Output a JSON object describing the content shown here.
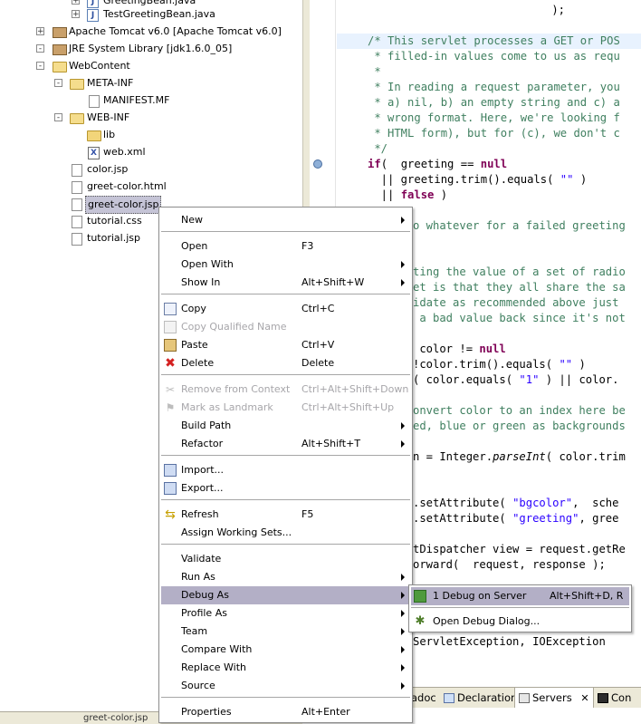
{
  "tree": {
    "items": [
      {
        "label": "GreetingBean.java",
        "icon": "java-file-icon"
      },
      {
        "label": "TestGreetingBean.java",
        "icon": "java-file-icon"
      },
      {
        "label": "Apache Tomcat v6.0 [Apache Tomcat v6.0]",
        "icon": "library-jar-icon"
      },
      {
        "label": "JRE System Library [jdk1.6.0_05]",
        "icon": "library-jar-icon"
      },
      {
        "label": "WebContent",
        "icon": "folder-open-icon"
      },
      {
        "label": "META-INF",
        "icon": "folder-open-icon"
      },
      {
        "label": "MANIFEST.MF",
        "icon": "file-icon"
      },
      {
        "label": "WEB-INF",
        "icon": "folder-open-icon"
      },
      {
        "label": "lib",
        "icon": "folder-icon"
      },
      {
        "label": "web.xml",
        "icon": "xml-file-icon"
      },
      {
        "label": "color.jsp",
        "icon": "file-icon"
      },
      {
        "label": "greet-color.html",
        "icon": "file-icon"
      },
      {
        "label": "greet-color.jsp",
        "icon": "file-icon"
      },
      {
        "label": "tutorial.css",
        "icon": "file-icon"
      },
      {
        "label": "tutorial.jsp",
        "icon": "file-icon"
      }
    ],
    "expanders": [
      "+",
      "+",
      "+",
      "-",
      "-",
      "-"
    ],
    "bottom_label": "greet-color.jsp"
  },
  "editor": {
    "lines": [
      "    );",
      "",
      "/* This servlet processes a GET or POS",
      " * filled-in values come to us as requ",
      " *",
      " * In reading a request parameter, you",
      " * a) nil, b) an empty string and c) a",
      " * wrong format. Here, we're looking f",
      " * HTML form), but for (c), we don't c",
      " */",
      "if(  greeting == null",
      "  || greeting.trim().equals( \"\" )",
      "  || false )",
      "",
      "o whatever for a failed greeting",
      "",
      "",
      "ting the value of a set of radio",
      "et is that they all share the sa",
      "idate as recommended above just",
      " a bad value back since it's not",
      "",
      " color != null",
      "!color.trim().equals( \"\" )",
      "( color.equals( \"1\" ) || color.",
      "",
      "onvert color to an index here be",
      "ed, blue or green as backgrounds",
      "",
      "n = Integer.parseInt( color.trim",
      "",
      "",
      ".setAttribute( \"bgcolor\",  sche",
      ".setAttribute( \"greeting\", gree",
      "",
      "tDispatcher view = request.getRe",
      "orward(  request, response );",
      "",
      "",
      "",
      "ServletException, IOException"
    ]
  },
  "bottom_tabs": {
    "tab_javadoc": "adoc",
    "tab_declaration": "Declaration",
    "tab_servers": "Servers",
    "tab_console": "Con",
    "close_glyph": "✕"
  },
  "context_menu": {
    "items": [
      {
        "label": "New",
        "shortcut": "",
        "submenu": true,
        "enabled": true
      },
      {
        "label": "Open",
        "shortcut": "F3",
        "submenu": false,
        "enabled": true
      },
      {
        "label": "Open With",
        "shortcut": "",
        "submenu": true,
        "enabled": true
      },
      {
        "label": "Show In",
        "shortcut": "Alt+Shift+W",
        "submenu": true,
        "enabled": true
      },
      {
        "label": "Copy",
        "shortcut": "Ctrl+C",
        "submenu": false,
        "enabled": true,
        "icon": "copy-icon"
      },
      {
        "label": "Copy Qualified Name",
        "shortcut": "",
        "submenu": false,
        "enabled": false,
        "icon": "copy-qualified-icon"
      },
      {
        "label": "Paste",
        "shortcut": "Ctrl+V",
        "submenu": false,
        "enabled": true,
        "icon": "paste-icon"
      },
      {
        "label": "Delete",
        "shortcut": "Delete",
        "submenu": false,
        "enabled": true,
        "icon": "delete-icon"
      },
      {
        "label": "Remove from Context",
        "shortcut": "Ctrl+Alt+Shift+Down",
        "submenu": false,
        "enabled": false,
        "icon": "remove-context-icon"
      },
      {
        "label": "Mark as Landmark",
        "shortcut": "Ctrl+Alt+Shift+Up",
        "submenu": false,
        "enabled": false,
        "icon": "landmark-icon"
      },
      {
        "label": "Build Path",
        "shortcut": "",
        "submenu": true,
        "enabled": true
      },
      {
        "label": "Refactor",
        "shortcut": "Alt+Shift+T",
        "submenu": true,
        "enabled": true
      },
      {
        "label": "Import...",
        "shortcut": "",
        "submenu": false,
        "enabled": true,
        "icon": "import-icon"
      },
      {
        "label": "Export...",
        "shortcut": "",
        "submenu": false,
        "enabled": true,
        "icon": "export-icon"
      },
      {
        "label": "Refresh",
        "shortcut": "F5",
        "submenu": false,
        "enabled": true,
        "icon": "refresh-icon"
      },
      {
        "label": "Assign Working Sets...",
        "shortcut": "",
        "submenu": false,
        "enabled": true
      },
      {
        "label": "Validate",
        "shortcut": "",
        "submenu": false,
        "enabled": true
      },
      {
        "label": "Run As",
        "shortcut": "",
        "submenu": true,
        "enabled": true
      },
      {
        "label": "Debug As",
        "shortcut": "",
        "submenu": true,
        "enabled": true,
        "highlighted": true
      },
      {
        "label": "Profile As",
        "shortcut": "",
        "submenu": true,
        "enabled": true
      },
      {
        "label": "Team",
        "shortcut": "",
        "submenu": true,
        "enabled": true
      },
      {
        "label": "Compare With",
        "shortcut": "",
        "submenu": true,
        "enabled": true
      },
      {
        "label": "Replace With",
        "shortcut": "",
        "submenu": true,
        "enabled": true
      },
      {
        "label": "Source",
        "shortcut": "",
        "submenu": true,
        "enabled": true
      },
      {
        "label": "Properties",
        "shortcut": "Alt+Enter",
        "submenu": false,
        "enabled": true
      }
    ]
  },
  "debug_submenu": {
    "items": [
      {
        "label": "1 Debug on Server",
        "shortcut": "Alt+Shift+D, R",
        "icon": "debug-server-icon",
        "highlighted": true
      },
      {
        "label": "Open Debug Dialog...",
        "shortcut": "",
        "icon": "debug-bug-icon"
      }
    ]
  },
  "colors": {
    "menu_highlight": "#b3afc6",
    "comment": "#3f7f5f",
    "keyword": "#7f0055",
    "string": "#2a00ff"
  }
}
